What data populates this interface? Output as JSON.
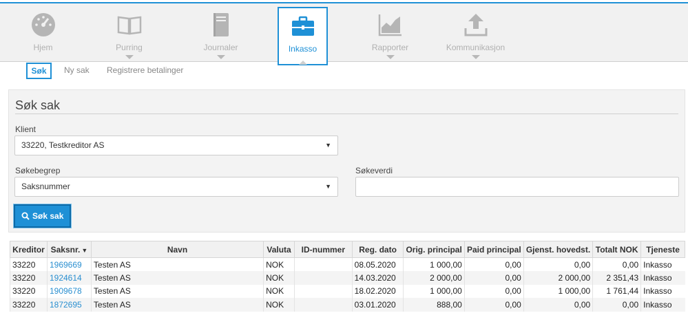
{
  "topnav": {
    "items": [
      {
        "label": "Hjem",
        "icon": "dashboard-gauge-icon"
      },
      {
        "label": "Purring",
        "icon": "open-book-icon"
      },
      {
        "label": "Journaler",
        "icon": "notebook-icon"
      },
      {
        "label": "Inkasso",
        "icon": "briefcase-icon",
        "active": true
      },
      {
        "label": "Rapporter",
        "icon": "area-chart-icon"
      },
      {
        "label": "Kommunikasjon",
        "icon": "upload-icon"
      }
    ]
  },
  "subnav": {
    "items": [
      "Søk",
      "Ny sak",
      "Registrere betalinger"
    ]
  },
  "search": {
    "title": "Søk sak",
    "client_label": "Klient",
    "client_value": "33220, Testkreditor AS",
    "term_label": "Søkebegrep",
    "term_value": "Saksnummer",
    "value_label": "Søkeverdi",
    "value_value": "",
    "button_label": "Søk sak"
  },
  "table": {
    "headers": [
      "Kreditor",
      "Saksnr.",
      "Navn",
      "Valuta",
      "ID-nummer",
      "Reg. dato",
      "Orig. principal",
      "Paid principal",
      "Gjenst. hovedst.",
      "Totalt NOK",
      "Tjeneste"
    ],
    "sort_indicator": "▼",
    "rows": [
      [
        "33220",
        "1969669",
        "Testen AS",
        "NOK",
        "",
        "08.05.2020",
        "1 000,00",
        "0,00",
        "0,00",
        "0,00",
        "Inkasso"
      ],
      [
        "33220",
        "1924614",
        "Testen AS",
        "NOK",
        "",
        "14.03.2020",
        "2 000,00",
        "0,00",
        "2 000,00",
        "2 351,43",
        "Inkasso"
      ],
      [
        "33220",
        "1909678",
        "Testen AS",
        "NOK",
        "",
        "18.02.2020",
        "1 000,00",
        "0,00",
        "1 000,00",
        "1 761,44",
        "Inkasso"
      ],
      [
        "33220",
        "1872695",
        "Testen AS",
        "NOK",
        "",
        "03.01.2020",
        "888,00",
        "0,00",
        "0,00",
        "0,00",
        "Inkasso"
      ]
    ]
  },
  "colors": {
    "accent": "#1e90d6",
    "link": "#2a8fd0",
    "inactive_nav": "#b0b0b0"
  }
}
